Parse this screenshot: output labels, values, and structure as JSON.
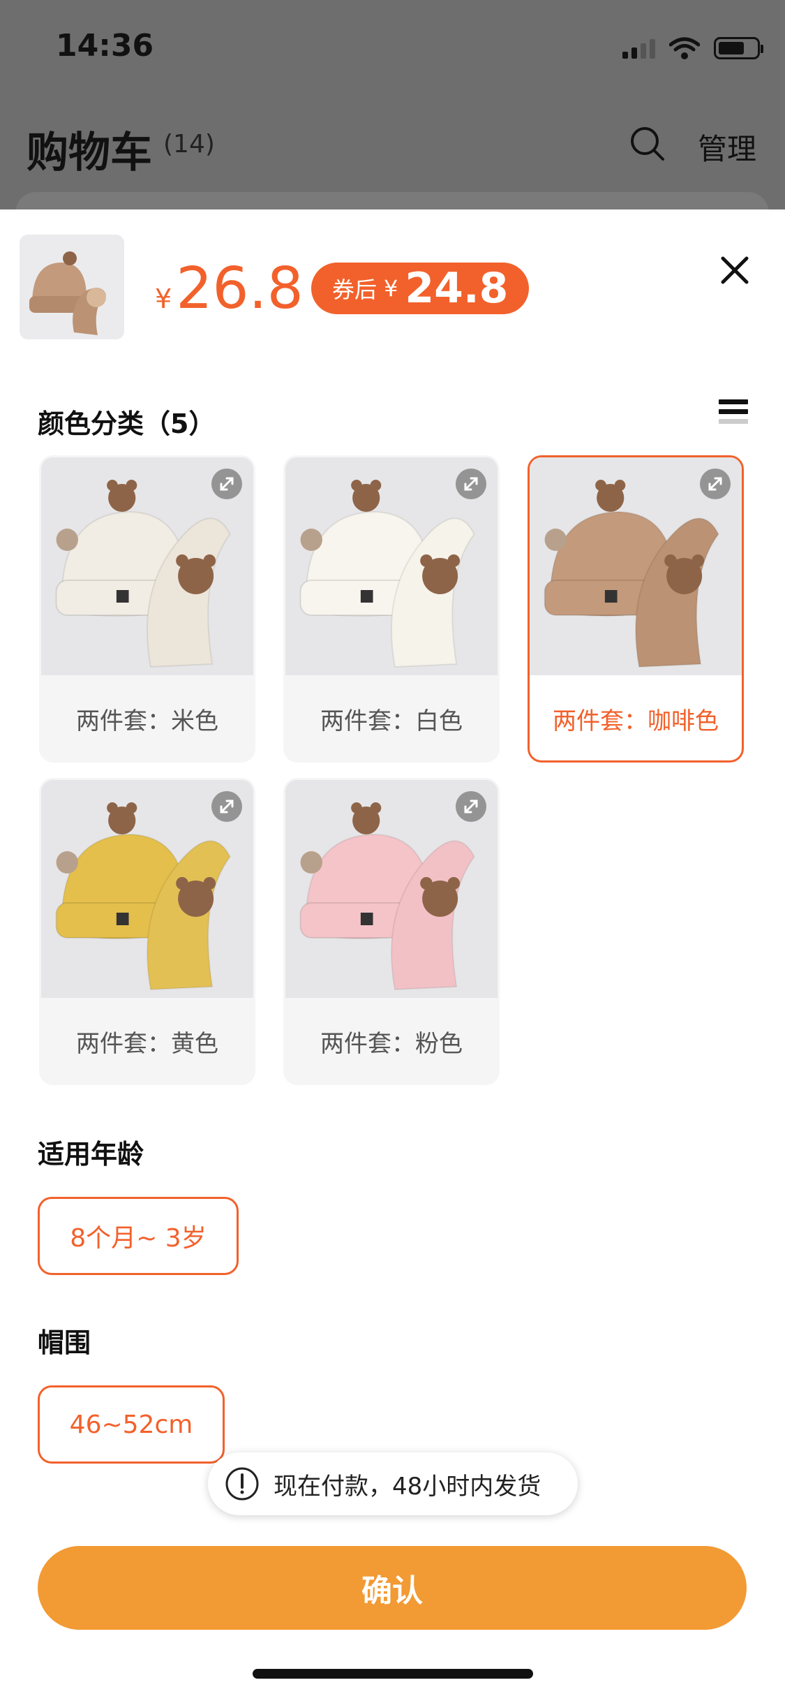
{
  "status_bar": {
    "time": "14:36"
  },
  "background": {
    "cart_title": "购物车",
    "cart_count": "(14)",
    "manage_label": "管理"
  },
  "product": {
    "price_currency": "¥",
    "price": "26.8",
    "coupon_label": "券后",
    "coupon_currency": "¥",
    "coupon_price": "24.8"
  },
  "color_section": {
    "title": "颜色分类（5）",
    "options": [
      {
        "label": "两件套：米色",
        "selected": false,
        "hat": "#f1ece4",
        "scarf": "#ece5da"
      },
      {
        "label": "两件套：白色",
        "selected": false,
        "hat": "#f8f5ee",
        "scarf": "#f6f3ea"
      },
      {
        "label": "两件套：咖啡色",
        "selected": true,
        "hat": "#c39a7c",
        "scarf": "#bb9274"
      },
      {
        "label": "两件套：黄色",
        "selected": false,
        "hat": "#e4bf4c",
        "scarf": "#e3c054"
      },
      {
        "label": "两件套：粉色",
        "selected": false,
        "hat": "#f4c4c8",
        "scarf": "#f2c1c6"
      }
    ]
  },
  "age_section": {
    "title": "适用年龄",
    "option": "8个月~ 3岁"
  },
  "size_section": {
    "title": "帽围",
    "option": "46~52cm"
  },
  "toast": {
    "text": "现在付款，48小时内发货"
  },
  "confirm_label": "确认",
  "colors": {
    "accent": "#f2612b",
    "confirm": "#f29a33"
  }
}
